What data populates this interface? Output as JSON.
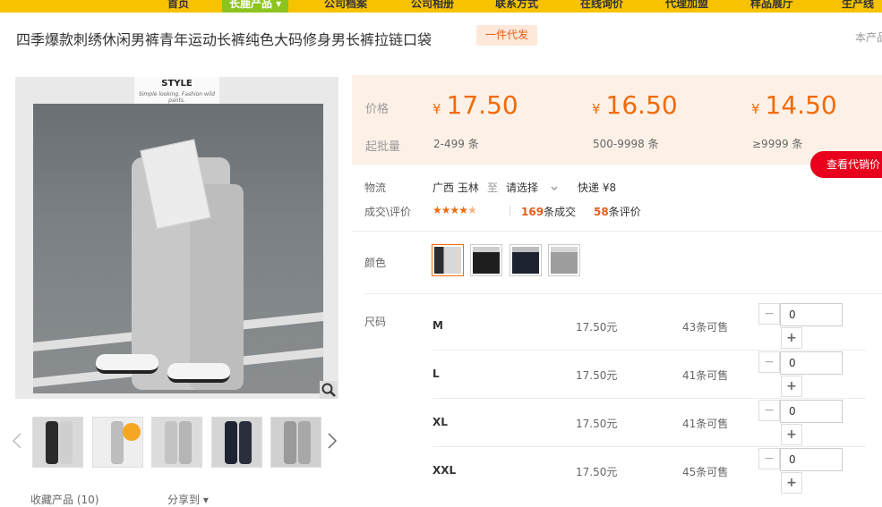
{
  "nav": {
    "items": [
      "首页",
      "长鹿产品 ▾",
      "公司档案",
      "公司相册",
      "联系方式",
      "在线询价",
      "代理加盟",
      "样品展厅",
      "生产线"
    ],
    "active_index": 1,
    "bg_color": "#f7c300",
    "active_color": "#8dc31f"
  },
  "product": {
    "title": "四季爆款刺绣休闲男裤青年运动长裤纯色大码修身男长裤拉链口袋",
    "badge": "一件代发",
    "right_note": "本产品"
  },
  "gallery": {
    "style_card_title": "STYLE",
    "style_card_sub": "Simple looking. Fashion wild pants.",
    "zoom_icon": "magnifier-icon",
    "prev_icon": "chevron-left-icon",
    "next_icon": "chevron-right-icon",
    "thumb_count": 5
  },
  "pricing": {
    "price_label": "价格",
    "moq_label": "起批量",
    "currency": "¥",
    "tiers": [
      {
        "price": "17.50",
        "range": "2-499",
        "unit": "条"
      },
      {
        "price": "16.50",
        "range": "500-9998",
        "unit": "条"
      },
      {
        "price": "14.50",
        "range": "≥9999",
        "unit": "条"
      }
    ],
    "price_color": "#f06b0a",
    "agent_button": "查看代销价"
  },
  "logistics": {
    "label": "物流",
    "from": "广西 玉林",
    "to_word": "至",
    "select": "请选择",
    "express": "快递 ¥8"
  },
  "deals": {
    "label": "成交\\评价",
    "rating_stars": 4.5,
    "deal_count": "169",
    "deal_suffix": "条成交",
    "review_count": "58",
    "review_suffix": "条评价"
  },
  "colors": {
    "label": "颜色",
    "swatches": [
      "black-white-photo",
      "black-photo",
      "navy-photo",
      "grey-photo"
    ],
    "selected_index": 0
  },
  "sizes": {
    "label": "尺码",
    "rows": [
      {
        "name": "M",
        "price": "17.50元",
        "stock": "43条可售",
        "qty": "0"
      },
      {
        "name": "L",
        "price": "17.50元",
        "stock": "41条可售",
        "qty": "0"
      },
      {
        "name": "XL",
        "price": "17.50元",
        "stock": "41条可售",
        "qty": "0"
      },
      {
        "name": "XXL",
        "price": "17.50元",
        "stock": "45条可售",
        "qty": "0"
      }
    ],
    "minus": "−",
    "plus": "+"
  },
  "footer": {
    "fav": "收藏产品 (10)",
    "share": "分享到 ▾"
  }
}
